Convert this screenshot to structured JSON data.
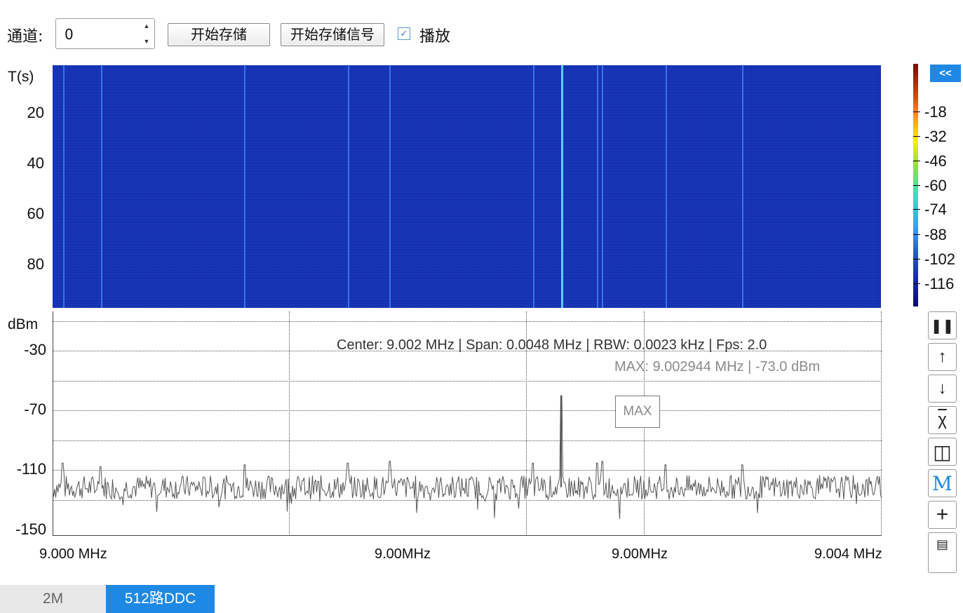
{
  "toolbar": {
    "channel_label": "通道:",
    "channel_value": "0",
    "start_store_label": "开始存储",
    "start_store_signal_label": "开始存储信号",
    "play_checked": true,
    "play_label": "播放"
  },
  "waterfall": {
    "y_unit": "T(s)",
    "y_ticks": [
      "20",
      "40",
      "60",
      "80"
    ],
    "background_color": "#1533b6",
    "line_color": "#3f7ef0",
    "peak_color": "#56d0f4"
  },
  "colorbar": {
    "collapse_label": "<<",
    "ticks": [
      "-18",
      "-32",
      "-46",
      "-60",
      "-74",
      "-88",
      "-102",
      "-116"
    ]
  },
  "spectrum": {
    "y_unit": "dBm",
    "y_ticks": [
      "-30",
      "-70",
      "-110",
      "-150"
    ],
    "info_line": "Center: 9.002 MHz | Span: 0.0048 MHz | RBW: 0.0023 kHz | Fps: 2.0",
    "max_line": "MAX: 9.002944 MHz | -73.0 dBm",
    "max_marker": "MAX",
    "x_ticks": [
      "9.000 MHz",
      "9.00MHz",
      "9.00MHz",
      "9.004 MHz"
    ]
  },
  "chart_data": {
    "type": "line",
    "title": "",
    "xlabel": "",
    "ylabel": "dBm",
    "xlim": [
      9.0,
      9.0048
    ],
    "ylim": [
      -150,
      -30
    ],
    "grid": true,
    "noise_floor_dbm": -126,
    "peak": {
      "freq_mhz": 9.002944,
      "dbm": -73.0
    },
    "spurs": [
      {
        "freq_mhz": 9.00006,
        "dbm": -112
      },
      {
        "freq_mhz": 9.00028,
        "dbm": -114
      },
      {
        "freq_mhz": 9.00111,
        "dbm": -113
      },
      {
        "freq_mhz": 9.00171,
        "dbm": -112
      },
      {
        "freq_mhz": 9.00195,
        "dbm": -111
      },
      {
        "freq_mhz": 9.00278,
        "dbm": -112
      },
      {
        "freq_mhz": 9.00315,
        "dbm": -112
      },
      {
        "freq_mhz": 9.00318,
        "dbm": -111
      },
      {
        "freq_mhz": 9.00355,
        "dbm": -113
      },
      {
        "freq_mhz": 9.00399,
        "dbm": -113
      }
    ]
  },
  "side_tools": [
    "pause-icon",
    "arrow-up-icon",
    "arrow-down-icon",
    "chi-icon",
    "fit-icon",
    "max-marker-icon",
    "plus-icon",
    "ruler-icon"
  ],
  "tabs": [
    {
      "label": "2M",
      "active": false
    },
    {
      "label": "512路DDC",
      "active": true
    }
  ]
}
